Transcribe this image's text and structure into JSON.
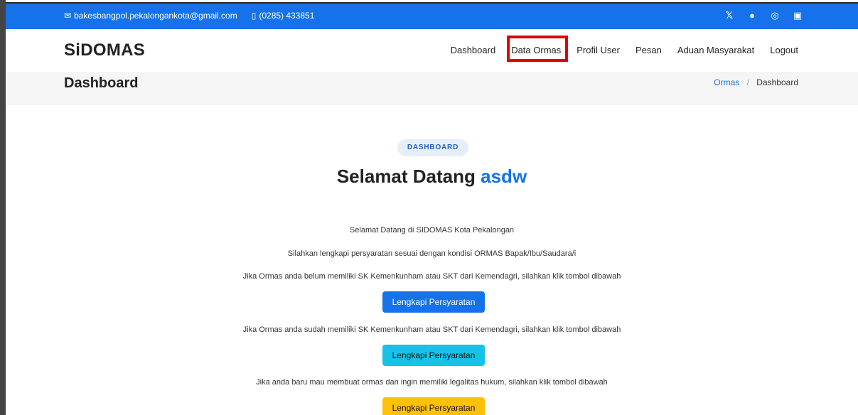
{
  "topbar": {
    "email": "bakesbangpol.pekalongankota@gmail.com",
    "phone": "(0285) 433851",
    "social": [
      "x-icon",
      "facebook-icon",
      "instagram-icon",
      "linkedin-icon"
    ]
  },
  "navbar": {
    "brand": "SiDOMAS",
    "menu": [
      "Dashboard",
      "Data Ormas",
      "Profil User",
      "Pesan",
      "Aduan Masyarakat",
      "Logout"
    ]
  },
  "pagehead": {
    "title": "Dashboard",
    "breadcrumb": [
      "Ormas",
      "/",
      "Dashboard"
    ]
  },
  "main": {
    "badge": "DASHBOARD",
    "welcome_prefix": "Selamat Datang",
    "welcome_name": "asdw",
    "lines": [
      "Selamat Datang di SIDOMAS Kota Pekalongan",
      "Silahkan lengkapi persyaratan sesuai dengan kondisi ORMAS Bapak/Ibu/Saudara/i",
      "Jika Ormas anda belum memiliki SK Kemenkunham atau SKT dari Kemendagri, silahkan klik tombol dibawah",
      "Jika Ormas anda sudah memiliki SK Kemenkunham atau SKT dari Kemendagri, silahkan klik tombol dibawah",
      "Jika anda baru mau membuat ormas dan ingin memiliki legalitas hukum, silahkan klik tombol dibawah"
    ],
    "button_label": "Lengkapi Persyaratan"
  },
  "colors": {
    "primary": "#1572ea",
    "info": "#17c1e8",
    "warning": "#ffc107",
    "highlight": "#e00000"
  }
}
